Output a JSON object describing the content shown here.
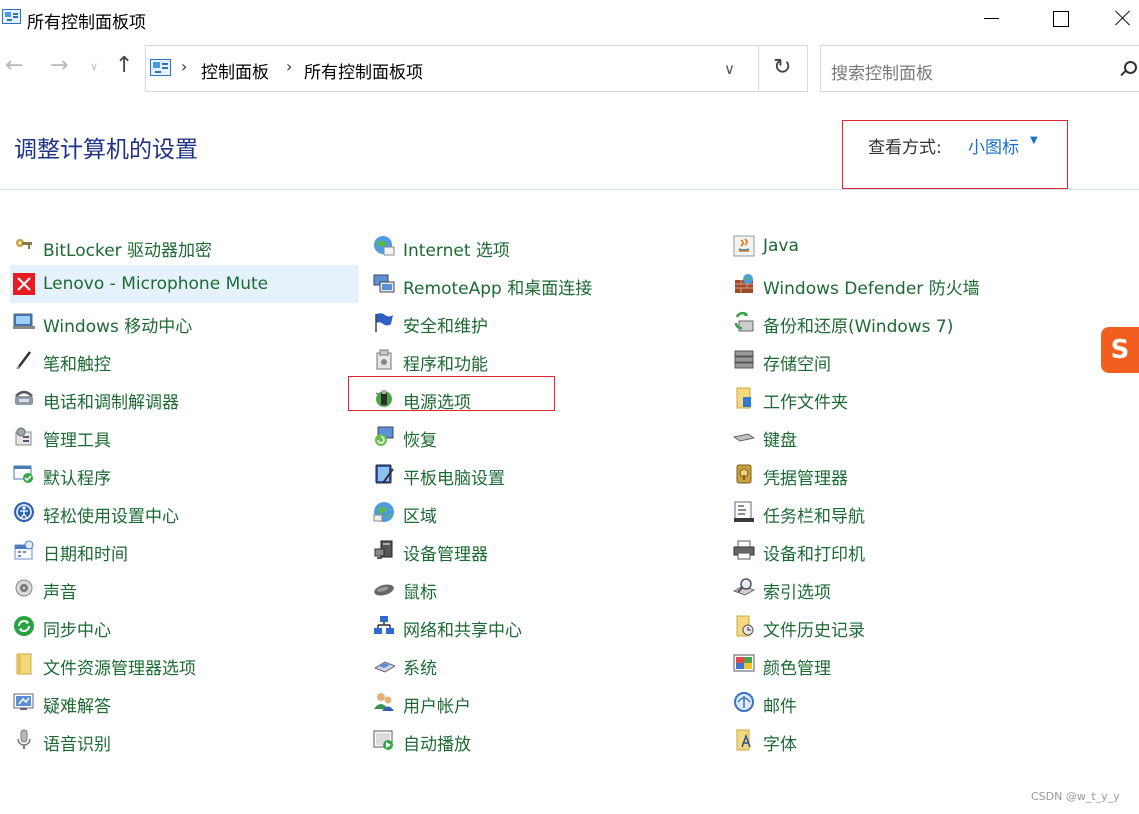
{
  "window": {
    "title": "所有控制面板项"
  },
  "address": {
    "crumbs": [
      "控制面板",
      "所有控制面板项"
    ]
  },
  "search": {
    "placeholder": "搜索控制面板"
  },
  "header": {
    "title": "调整计算机的设置",
    "view_by_label": "查看方式:",
    "view_by_value": "小图标"
  },
  "columns": [
    {
      "items": [
        {
          "label": "BitLocker 驱动器加密",
          "icon": "bitlocker-key-icon"
        },
        {
          "label": "Lenovo - Microphone Mute",
          "icon": "microphone-mute-icon"
        },
        {
          "label": "Windows 移动中心",
          "icon": "mobility-center-icon"
        },
        {
          "label": "笔和触控",
          "icon": "pen-icon"
        },
        {
          "label": "电话和调制解调器",
          "icon": "phone-modem-icon"
        },
        {
          "label": "管理工具",
          "icon": "admin-tools-icon"
        },
        {
          "label": "默认程序",
          "icon": "default-programs-icon"
        },
        {
          "label": "轻松使用设置中心",
          "icon": "ease-of-access-icon"
        },
        {
          "label": "日期和时间",
          "icon": "date-time-icon"
        },
        {
          "label": "声音",
          "icon": "speaker-icon"
        },
        {
          "label": "同步中心",
          "icon": "sync-icon"
        },
        {
          "label": "文件资源管理器选项",
          "icon": "folder-options-icon"
        },
        {
          "label": "疑难解答",
          "icon": "troubleshoot-icon"
        },
        {
          "label": "语音识别",
          "icon": "microphone-icon"
        }
      ]
    },
    {
      "items": [
        {
          "label": "Internet 选项",
          "icon": "internet-globe-icon"
        },
        {
          "label": "RemoteApp 和桌面连接",
          "icon": "remoteapp-icon"
        },
        {
          "label": "安全和维护",
          "icon": "security-flag-icon"
        },
        {
          "label": "程序和功能",
          "icon": "programs-features-icon"
        },
        {
          "label": "电源选项",
          "icon": "power-options-icon"
        },
        {
          "label": "恢复",
          "icon": "recovery-icon"
        },
        {
          "label": "平板电脑设置",
          "icon": "tablet-settings-icon"
        },
        {
          "label": "区域",
          "icon": "region-globe-icon"
        },
        {
          "label": "设备管理器",
          "icon": "device-manager-icon"
        },
        {
          "label": "鼠标",
          "icon": "mouse-icon"
        },
        {
          "label": "网络和共享中心",
          "icon": "network-icon"
        },
        {
          "label": "系统",
          "icon": "system-icon"
        },
        {
          "label": "用户帐户",
          "icon": "user-accounts-icon"
        },
        {
          "label": "自动播放",
          "icon": "autoplay-icon"
        }
      ]
    },
    {
      "items": [
        {
          "label": "Java",
          "icon": "java-icon"
        },
        {
          "label": "Windows Defender 防火墙",
          "icon": "firewall-icon"
        },
        {
          "label": "备份和还原(Windows 7)",
          "icon": "backup-restore-icon"
        },
        {
          "label": "存储空间",
          "icon": "storage-spaces-icon"
        },
        {
          "label": "工作文件夹",
          "icon": "work-folders-icon"
        },
        {
          "label": "键盘",
          "icon": "keyboard-icon"
        },
        {
          "label": "凭据管理器",
          "icon": "credential-manager-icon"
        },
        {
          "label": "任务栏和导航",
          "icon": "taskbar-icon"
        },
        {
          "label": "设备和打印机",
          "icon": "printer-icon"
        },
        {
          "label": "索引选项",
          "icon": "indexing-icon"
        },
        {
          "label": "文件历史记录",
          "icon": "file-history-icon"
        },
        {
          "label": "颜色管理",
          "icon": "color-management-icon"
        },
        {
          "label": "邮件",
          "icon": "mail-icon"
        },
        {
          "label": "字体",
          "icon": "fonts-icon"
        }
      ]
    }
  ],
  "ime": {
    "text": "S"
  },
  "watermark": "CSDN @w_t_y_y"
}
